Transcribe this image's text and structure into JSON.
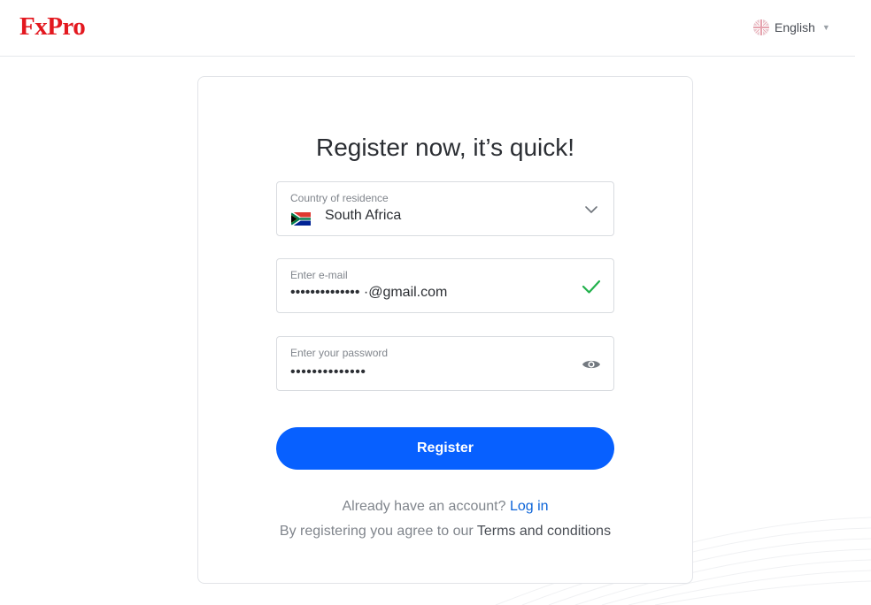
{
  "header": {
    "logo_text": "FxPro",
    "language": {
      "label": "English",
      "icon": "uk-flag-icon"
    }
  },
  "form": {
    "title": "Register now, it’s quick!",
    "country": {
      "label": "Country of residence",
      "value": "South Africa",
      "icon": "south-africa-flag-icon"
    },
    "email": {
      "label": "Enter e-mail",
      "value": "•••••••••••••• ·@gmail.com",
      "status_icon": "checkmark-icon"
    },
    "password": {
      "label": "Enter your password",
      "value": "••••••••••••••",
      "toggle_icon": "eye-icon"
    },
    "register_label": "Register",
    "login_prompt": "Already have an account?",
    "login_link": "Log in",
    "terms_prompt": "By registering you agree to our",
    "terms_link": "Terms and conditions"
  },
  "colors": {
    "brand_red": "#e3181f",
    "primary_blue": "#0760ff",
    "link_blue": "#0b63d8",
    "success_green": "#22b14c"
  }
}
